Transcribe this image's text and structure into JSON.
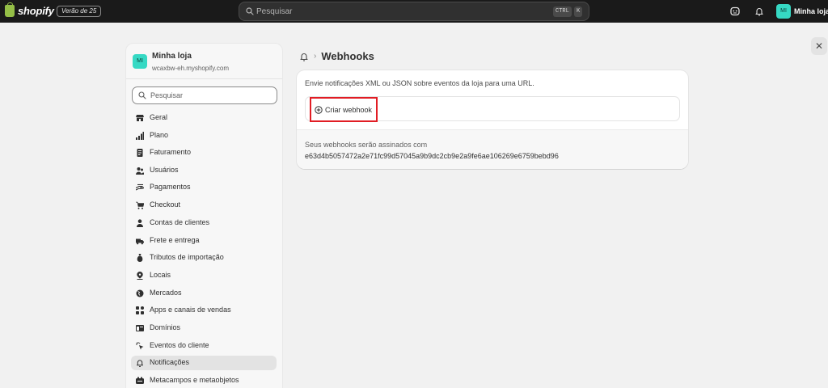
{
  "topbar": {
    "logo_text": "shopify",
    "version_badge": "Verão de 25",
    "search_placeholder": "Pesquisar",
    "shortcut_ctrl": "CTRL",
    "shortcut_k": "K",
    "avatar_initials": "MI",
    "store_name": "Minha loja"
  },
  "sidebar": {
    "store_avatar": "MI",
    "store_name": "Minha loja",
    "store_domain": "wcaxbw-eh.myshopify.com",
    "search_placeholder": "Pesquisar",
    "items": [
      {
        "label": "Geral",
        "icon": "store-icon"
      },
      {
        "label": "Plano",
        "icon": "chart-icon"
      },
      {
        "label": "Faturamento",
        "icon": "receipt-icon"
      },
      {
        "label": "Usuários",
        "icon": "users-icon"
      },
      {
        "label": "Pagamentos",
        "icon": "payments-icon"
      },
      {
        "label": "Checkout",
        "icon": "cart-icon"
      },
      {
        "label": "Contas de clientes",
        "icon": "person-icon"
      },
      {
        "label": "Frete e entrega",
        "icon": "truck-icon"
      },
      {
        "label": "Tributos de importação",
        "icon": "money-bag-icon"
      },
      {
        "label": "Locais",
        "icon": "location-icon"
      },
      {
        "label": "Mercados",
        "icon": "globe-icon"
      },
      {
        "label": "Apps e canais de vendas",
        "icon": "apps-icon"
      },
      {
        "label": "Domínios",
        "icon": "domain-icon"
      },
      {
        "label": "Eventos do cliente",
        "icon": "cursor-icon"
      },
      {
        "label": "Notificações",
        "icon": "bell-icon",
        "active": true
      },
      {
        "label": "Metacampos e metaobjetos",
        "icon": "metafields-icon"
      }
    ]
  },
  "content": {
    "breadcrumb_sep": "›",
    "page_title": "Webhooks",
    "description": "Envie notificações XML ou JSON sobre eventos da loja para uma URL.",
    "create_button": "Criar webhook",
    "footer_text": "Seus webhooks serão assinados com",
    "signing_hash": "e63d4b5057472a2e71fc99d57045a9b9dc2cb9e2a9fe6ae106269e6759bebd96"
  },
  "close_label": "✕",
  "colors": {
    "topbar_bg": "#1a1a1a",
    "avatar": "#36d9c4",
    "logo_green": "#95bf47",
    "highlight_red": "#e11d24"
  }
}
